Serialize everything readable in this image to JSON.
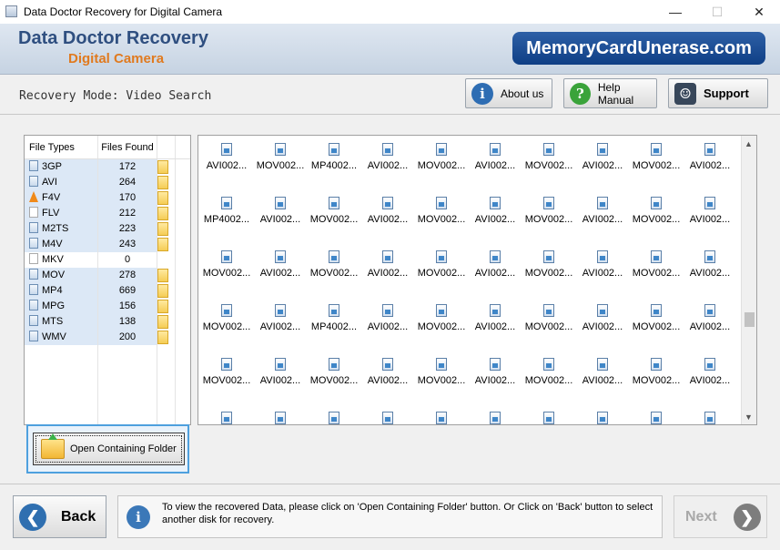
{
  "window": {
    "title": "Data Doctor Recovery for Digital Camera",
    "min_glyph": "—",
    "max_glyph": "☐",
    "close_glyph": "✕"
  },
  "header": {
    "brand_line1": "Data Doctor Recovery",
    "brand_line2": "Digital Camera",
    "logo_text": "MemoryCardUnerase.com"
  },
  "mode_label": "Recovery Mode: Video Search",
  "toolbar": {
    "about_label": "About us",
    "about_icon": "info-icon",
    "help_label": "Help Manual",
    "help_icon": "question-icon",
    "support_label": "Support",
    "support_icon": "support-person-icon"
  },
  "file_types": {
    "col_type": "File Types",
    "col_found": "Files Found",
    "rows": [
      {
        "type": "3GP",
        "found": "172",
        "has_folder": true
      },
      {
        "type": "AVI",
        "found": "264",
        "has_folder": true
      },
      {
        "type": "F4V",
        "found": "170",
        "has_folder": true
      },
      {
        "type": "FLV",
        "found": "212",
        "has_folder": true
      },
      {
        "type": "M2TS",
        "found": "223",
        "has_folder": true
      },
      {
        "type": "M4V",
        "found": "243",
        "has_folder": true
      },
      {
        "type": "MKV",
        "found": "0",
        "has_folder": false
      },
      {
        "type": "MOV",
        "found": "278",
        "has_folder": true
      },
      {
        "type": "MP4",
        "found": "669",
        "has_folder": true
      },
      {
        "type": "MPG",
        "found": "156",
        "has_folder": true
      },
      {
        "type": "MTS",
        "found": "138",
        "has_folder": true
      },
      {
        "type": "WMV",
        "found": "200",
        "has_folder": true
      }
    ]
  },
  "files_grid": [
    [
      "AVI002...",
      "MOV002...",
      "MP4002...",
      "AVI002...",
      "MOV002...",
      "AVI002...",
      "MOV002...",
      "AVI002...",
      "MOV002...",
      "AVI002..."
    ],
    [
      "MP4002...",
      "AVI002...",
      "MOV002...",
      "AVI002...",
      "MOV002...",
      "AVI002...",
      "MOV002...",
      "AVI002...",
      "MOV002...",
      "AVI002..."
    ],
    [
      "MOV002...",
      "AVI002...",
      "MOV002...",
      "AVI002...",
      "MOV002...",
      "AVI002...",
      "MOV002...",
      "AVI002...",
      "MOV002...",
      "AVI002..."
    ],
    [
      "MOV002...",
      "AVI002...",
      "MP4002...",
      "AVI002...",
      "MOV002...",
      "AVI002...",
      "MOV002...",
      "AVI002...",
      "MOV002...",
      "AVI002..."
    ],
    [
      "MOV002...",
      "AVI002...",
      "MOV002...",
      "AVI002...",
      "MOV002...",
      "AVI002...",
      "MOV002...",
      "AVI002...",
      "MOV002...",
      "AVI002..."
    ],
    [
      "",
      "",
      "",
      "",
      "",
      "",
      "",
      "",
      "",
      ""
    ]
  ],
  "open_folder_label": "Open Containing Folder",
  "back_label": "Back",
  "next_label": "Next",
  "info_text": "To view the recovered Data, please click on 'Open Containing Folder' button. Or Click on 'Back' button to select another disk for recovery.",
  "colors": {
    "brand_blue": "#2f4f80",
    "brand_orange": "#e07a1f",
    "selection": "#dce8f6",
    "focus_border": "#4ea0de"
  }
}
